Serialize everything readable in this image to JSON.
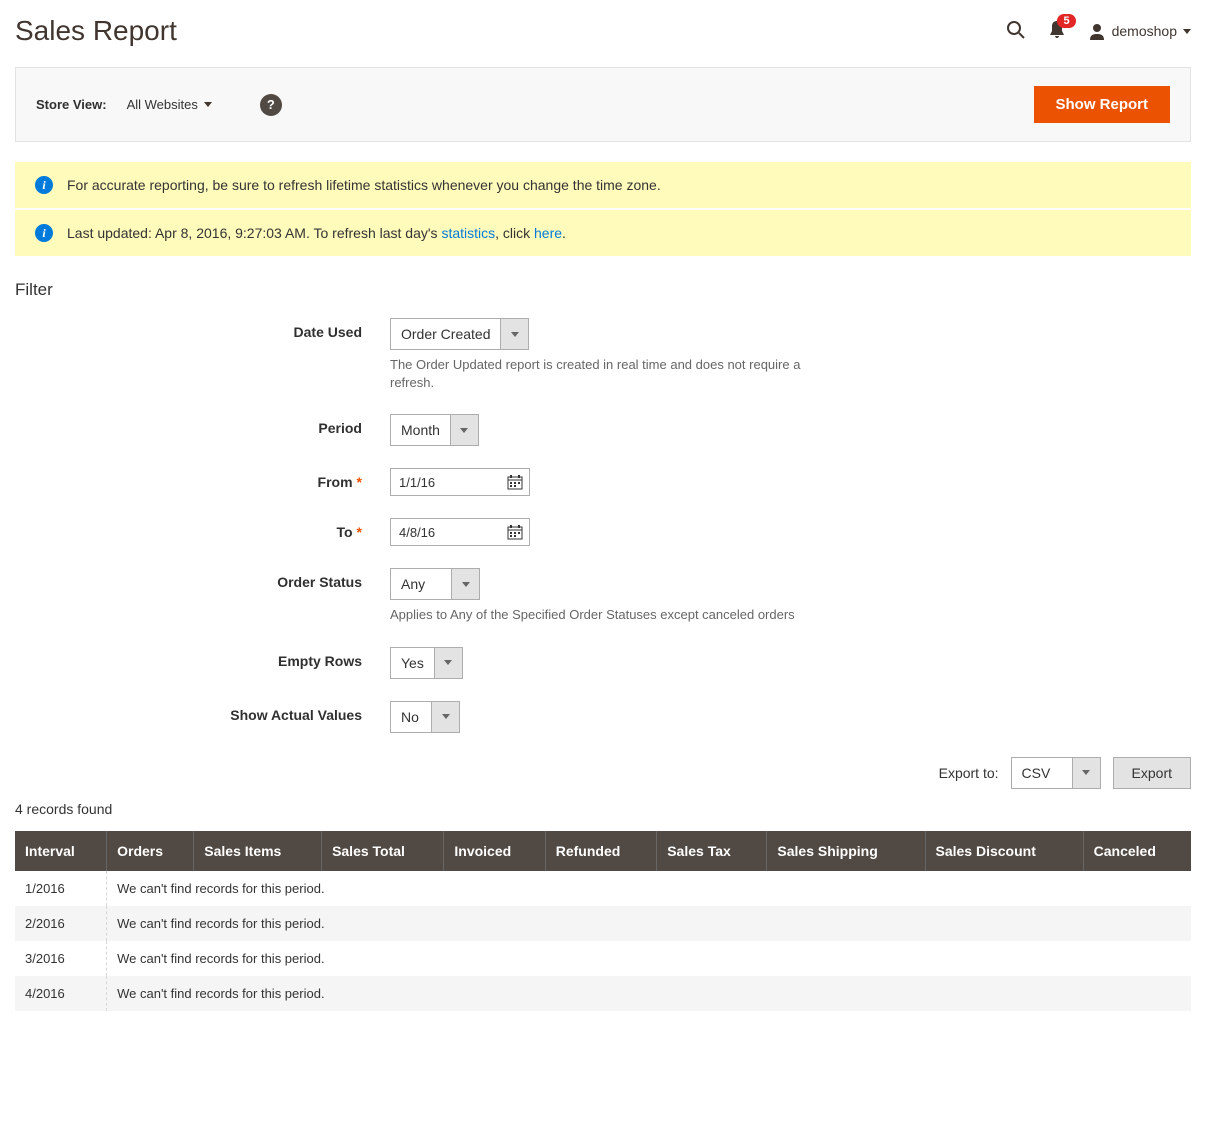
{
  "header": {
    "title": "Sales Report",
    "notification_count": "5",
    "username": "demoshop"
  },
  "toolbar": {
    "store_view_label": "Store View:",
    "store_view_value": "All Websites",
    "show_report_label": "Show Report"
  },
  "notices": {
    "notice1": "For accurate reporting, be sure to refresh lifetime statistics whenever you change the time zone.",
    "notice2_prefix": "Last updated: Apr 8, 2016, 9:27:03 AM. To refresh last day's ",
    "notice2_link1": "statistics",
    "notice2_mid": ", click ",
    "notice2_link2": "here",
    "notice2_suffix": "."
  },
  "filter": {
    "section_title": "Filter",
    "date_used_label": "Date Used",
    "date_used_value": "Order Created",
    "date_used_hint": "The Order Updated report is created in real time and does not require a refresh.",
    "period_label": "Period",
    "period_value": "Month",
    "from_label": "From",
    "from_value": "1/1/16",
    "to_label": "To",
    "to_value": "4/8/16",
    "order_status_label": "Order Status",
    "order_status_value": "Any",
    "order_status_hint": "Applies to Any of the Specified Order Statuses except canceled orders",
    "empty_rows_label": "Empty Rows",
    "empty_rows_value": "Yes",
    "show_actual_label": "Show Actual Values",
    "show_actual_value": "No"
  },
  "export": {
    "label": "Export to:",
    "format": "CSV",
    "button": "Export"
  },
  "results": {
    "records_found": "4 records found",
    "columns": [
      "Interval",
      "Orders",
      "Sales Items",
      "Sales Total",
      "Invoiced",
      "Refunded",
      "Sales Tax",
      "Sales Shipping",
      "Sales Discount",
      "Canceled"
    ],
    "rows": [
      {
        "interval": "1/2016",
        "message": "We can't find records for this period."
      },
      {
        "interval": "2/2016",
        "message": "We can't find records for this period."
      },
      {
        "interval": "3/2016",
        "message": "We can't find records for this period."
      },
      {
        "interval": "4/2016",
        "message": "We can't find records for this period."
      }
    ]
  }
}
